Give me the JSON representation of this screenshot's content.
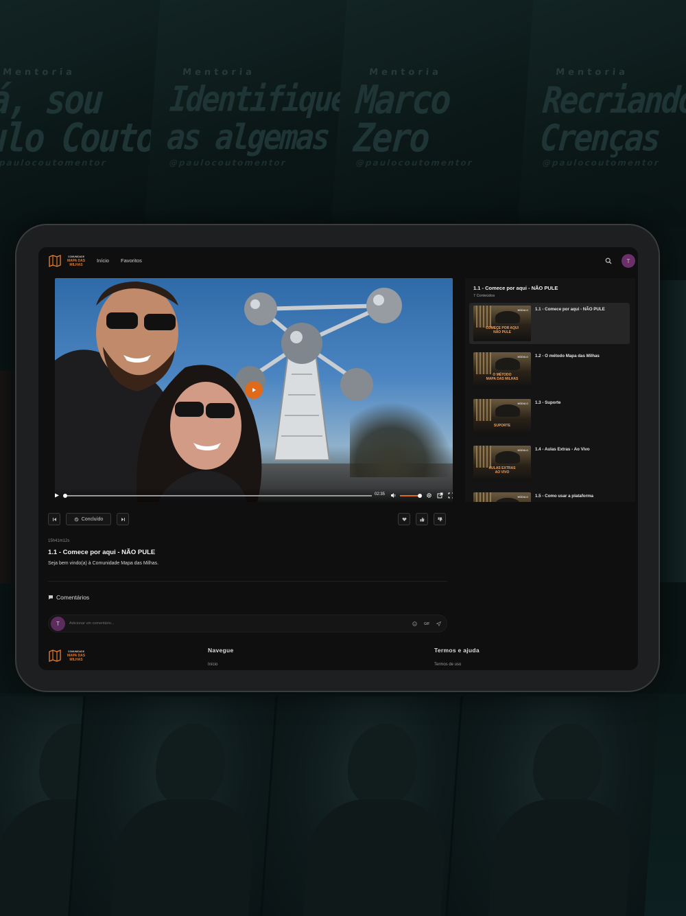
{
  "background": {
    "top_cards": [
      {
        "eyebrow": "Mentoria",
        "title": "á, sou\nulo Couto",
        "handle": "@paulocoutomentor"
      },
      {
        "eyebrow": "Mentoria",
        "title": "Identifique\nas algemas",
        "handle": "@paulocoutomentor"
      },
      {
        "eyebrow": "Mentoria",
        "title": "Marco\nZero",
        "handle": "@paulocoutomentor"
      },
      {
        "eyebrow": "Mentoria",
        "title": "Recriando\nCrenças",
        "handle": "@paulocoutomentor"
      }
    ]
  },
  "nav": {
    "logo_top": "COMUNIDADE",
    "logo_main": "MAPA DAS MILHAS",
    "links": [
      "Início",
      "Favoritos"
    ],
    "avatar_letter": "T"
  },
  "player": {
    "time": "02:35",
    "progress_fraction": 0.01,
    "volume_fraction": 1.0
  },
  "playlist": {
    "title": "1.1 - Comece por aqui - NÃO PULE",
    "subtitle": "7 Conteúdos",
    "items": [
      {
        "label": "1.1 - Comece por aqui - NÃO PULE",
        "thumb_text": "COMEÇE POR AQUI\nNÃO PULE",
        "tag": "MÓDULO",
        "active": true
      },
      {
        "label": "1.2 - O método Mapa das Milhas",
        "thumb_text": "O MÉTODO\nMAPA DAS MILHAS",
        "tag": "MÓDULO",
        "active": false
      },
      {
        "label": "1.3 - Suporte",
        "thumb_text": "SUPORTE",
        "tag": "MÓDULO",
        "active": false
      },
      {
        "label": "1.4 - Aulas Extras - Ao Vivo",
        "thumb_text": "AULAS EXTRAS\nAO VIVO",
        "tag": "MÓDULO",
        "active": false
      },
      {
        "label": "1.5 - Como usar a plataforma",
        "thumb_text": "",
        "tag": "MÓDULO",
        "active": false
      }
    ]
  },
  "actions": {
    "done_label": "Concluído"
  },
  "lesson": {
    "duration": "15h41m12s",
    "title": "1.1 - Comece por aqui - NÃO PULE",
    "description": "Seja bem vindo(a) à Comunidade Mapa das Milhas."
  },
  "comments": {
    "heading": "Comentários",
    "avatar_letter": "T",
    "placeholder": "Adicionar um comentário...",
    "gif_label": "GIF"
  },
  "footer": {
    "col1_heading": "Navegue",
    "col1_link": "Início",
    "col2_heading": "Termos e ajuda",
    "col2_link": "Termos de uso"
  },
  "colors": {
    "accent": "#e06a1c",
    "avatar": "#6b2f6b",
    "screen_bg": "#0f0f0f"
  }
}
